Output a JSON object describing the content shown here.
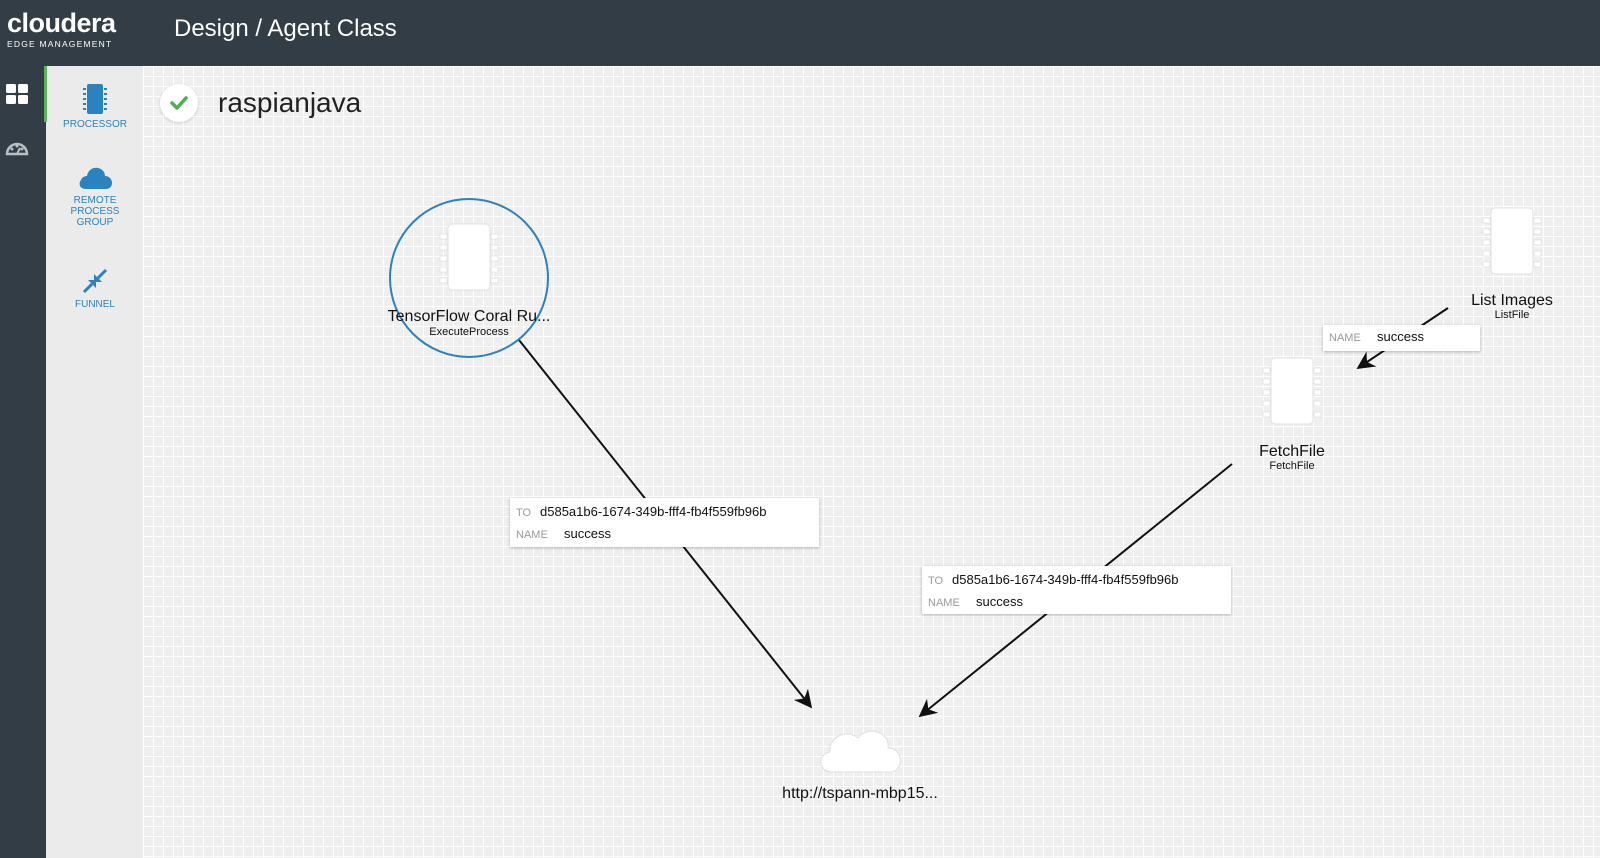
{
  "brand": {
    "name": "cloudera",
    "subtitle": "EDGE MANAGEMENT"
  },
  "header": {
    "breadcrumb": "Design / Agent Class"
  },
  "rail": {
    "icons": [
      "dashboard-grid-icon",
      "monitor-gauge-icon"
    ]
  },
  "palette": {
    "items": [
      {
        "label": "PROCESSOR",
        "icon": "chip-icon"
      },
      {
        "label": "REMOTE PROCESS GROUP",
        "icon": "cloud-icon"
      },
      {
        "label": "FUNNEL",
        "icon": "funnel-arrows-icon"
      }
    ],
    "rpg_lines": [
      "REMOTE",
      "PROCESS",
      "GROUP"
    ]
  },
  "flow": {
    "title": "raspianjava",
    "status": "check-icon",
    "status_color": "#4caf50"
  },
  "nodes": {
    "tensorflow": {
      "name": "TensorFlow Coral Ru...",
      "type": "ExecuteProcess"
    },
    "listimages": {
      "name": "List Images",
      "type": "ListFile"
    },
    "fetchfile": {
      "name": "FetchFile",
      "type": "FetchFile"
    },
    "remote": {
      "name": "http://tspann-mbp15..."
    }
  },
  "connections": {
    "c1": {
      "to_key": "TO",
      "to": "d585a1b6-1674-349b-fff4-fb4f559fb96b",
      "name_key": "NAME",
      "name": "success"
    },
    "c2": {
      "to_key": "TO",
      "to": "d585a1b6-1674-349b-fff4-fb4f559fb96b",
      "name_key": "NAME",
      "name": "success"
    },
    "c3": {
      "name_key": "NAME",
      "name": "success"
    }
  },
  "colors": {
    "header_bg": "#323d45",
    "accent_blue": "#2a82bf",
    "active_green": "#5bb556"
  }
}
